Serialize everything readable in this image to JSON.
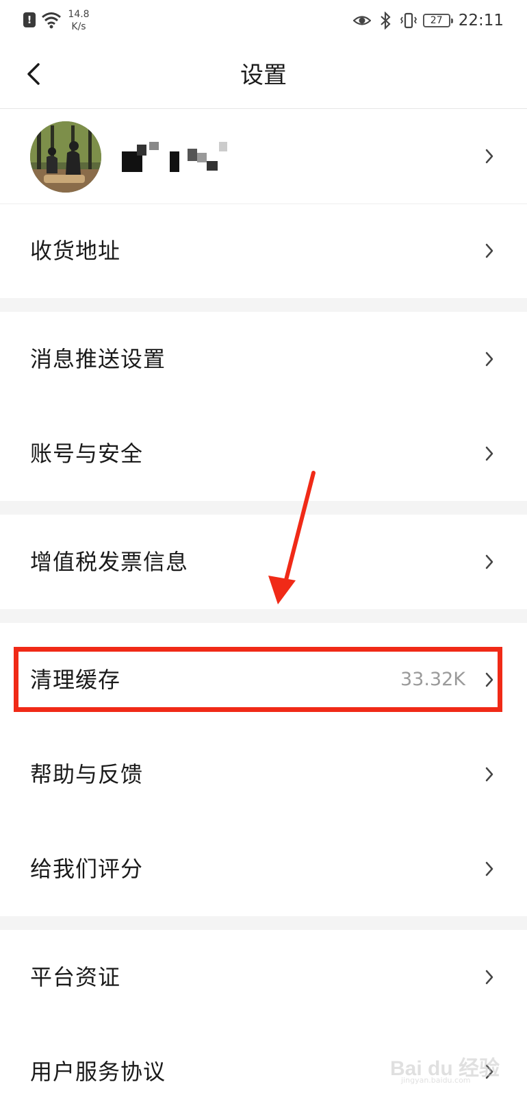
{
  "status_bar": {
    "net_speed_value": "14.8",
    "net_speed_unit": "K/s",
    "battery": "27",
    "time": "22:11",
    "icons": [
      "alert-icon",
      "wifi-icon",
      "eye-icon",
      "bluetooth-icon",
      "vibrate-icon",
      "battery-icon"
    ]
  },
  "header": {
    "title": "设置"
  },
  "settings": {
    "address": "收货地址",
    "push": "消息推送设置",
    "account": "账号与安全",
    "invoice": "增值税发票信息",
    "cache": "清理缓存",
    "cache_size": "33.32K",
    "feedback": "帮助与反馈",
    "rate": "给我们评分",
    "qualification": "平台资证",
    "agreement": "用户服务协议"
  },
  "watermark": {
    "text": "Bai du 经验",
    "sub": "jingyan.baidu.com"
  },
  "colors": {
    "highlight": "#f02a17",
    "divider": "#f4f4f4",
    "value_gray": "#9a9a9a"
  }
}
